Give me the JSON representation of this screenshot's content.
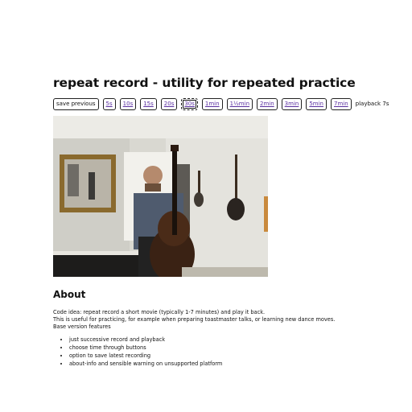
{
  "title": "repeat record - utility for repeated practice",
  "toolbar": {
    "save_label": "save previous",
    "durations": [
      "5s",
      "10s",
      "15s",
      "20s",
      "30s",
      "1min",
      "1½min",
      "2min",
      "3min",
      "5min",
      "7min"
    ],
    "active": "30s",
    "playback": "playback 7s"
  },
  "video": {
    "icon": "video-preview"
  },
  "about": {
    "heading": "About",
    "line1": "Code idea: repeat record a short movie (typically 1-7 minutes) and play it back.",
    "line2": "This is useful for practicing, for example when preparing toastmaster talks, or learning new dance moves.",
    "line3": "Base version features",
    "features": [
      "just successive record and playback",
      "choose time through buttons",
      "option to save latest recording",
      "about-info and sensible warning on unsupported platform"
    ]
  }
}
